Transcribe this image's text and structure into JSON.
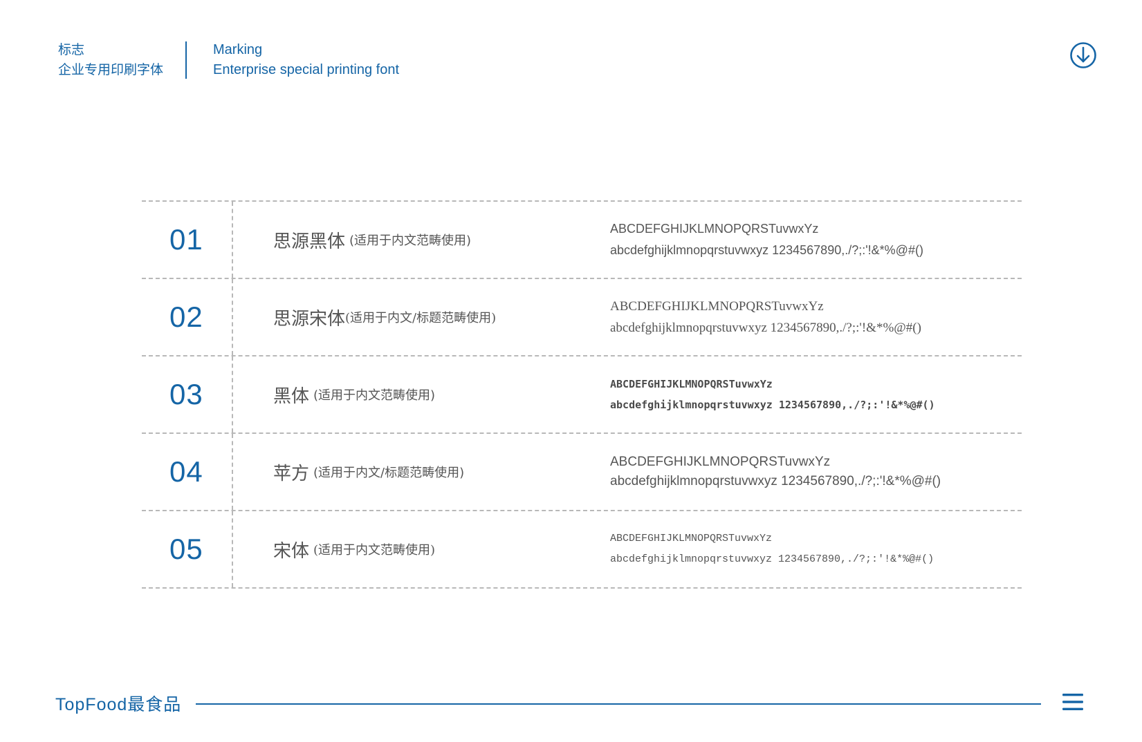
{
  "header": {
    "cn_line1": "标志",
    "cn_line2": "企业专用印刷字体",
    "en_line1": "Marking",
    "en_line2": "Enterprise special printing font",
    "download_icon": "arrow-down-circle-icon"
  },
  "rows": [
    {
      "num": "01",
      "name": "思源黑体",
      "usage": "(适用于内文范畴使用)",
      "upper": "ABCDEFGHIJKLMNOPQRSTuvwxYz",
      "lower": "abcdefghijklmnopqrstuvwxyz 1234567890,./?;:'!&*%@#()"
    },
    {
      "num": "02",
      "name": "思源宋体",
      "usage": "(适用于内文/标题范畴使用)",
      "upper": "ABCDEFGHIJKLMNOPQRSTuvwxYz",
      "lower": "abcdefghijklmnopqrstuvwxyz 1234567890,./?;:'!&*%@#()"
    },
    {
      "num": "03",
      "name": "黑体",
      "usage": "(适用于内文范畴使用)",
      "upper": "ABCDEFGHIJKLMNOPQRSTuvwxYz",
      "lower": "abcdefghijklmnopqrstuvwxyz 1234567890,./?;:'!&*%@#()"
    },
    {
      "num": "04",
      "name": "苹方",
      "usage": "(适用于内文/标题范畴使用)",
      "upper": "ABCDEFGHIJKLMNOPQRSTuvwxYz",
      "lower": "abcdefghijklmnopqrstuvwxyz 1234567890,./?;:'!&*%@#()"
    },
    {
      "num": "05",
      "name": "宋体",
      "usage": "(适用于内文范畴使用)",
      "upper": "ABCDEFGHIJKLMNOPQRSTuvwxYz",
      "lower": "abcdefghijklmnopqrstuvwxyz 1234567890,./?;:'!&*%@#()"
    }
  ],
  "footer": {
    "brand": "TopFood最食品",
    "menu_icon": "hamburger-menu-icon"
  },
  "colors": {
    "accent": "#1565a6",
    "text": "#555555",
    "dash": "#b8b8b8"
  }
}
